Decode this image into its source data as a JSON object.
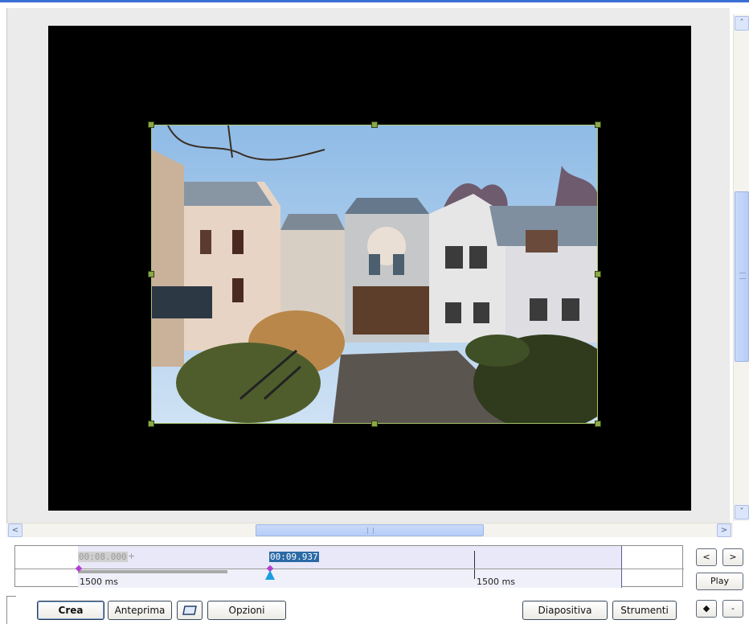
{
  "timeline": {
    "current_time": "00:08.000",
    "plus": "+",
    "selected_time": "00:09.937",
    "duration_left": "1500 ms",
    "duration_right": "1500 ms"
  },
  "side_buttons": {
    "prev": "<",
    "next": ">",
    "play": "Play",
    "pin": "◆",
    "minus": "-"
  },
  "toolbar": {
    "crea": "Crea",
    "anteprima": "Anteprima",
    "opzioni": "Opzioni",
    "diapositiva": "Diapositiva",
    "strumenti": "Strumenti"
  },
  "scroll": {
    "up": "˄",
    "down": "˅",
    "left": "<",
    "right": ">"
  },
  "icons": [
    "slide-icon",
    "scroll-up-icon",
    "scroll-down-icon",
    "scroll-left-icon",
    "scroll-right-icon",
    "pin-icon"
  ],
  "colors": {
    "stage": "#000000",
    "selection_handles": "#8aa846",
    "time_highlight": "#2a6aa6",
    "marker_purple": "#b23fd1",
    "marker_cyan": "#1aa0e0"
  }
}
